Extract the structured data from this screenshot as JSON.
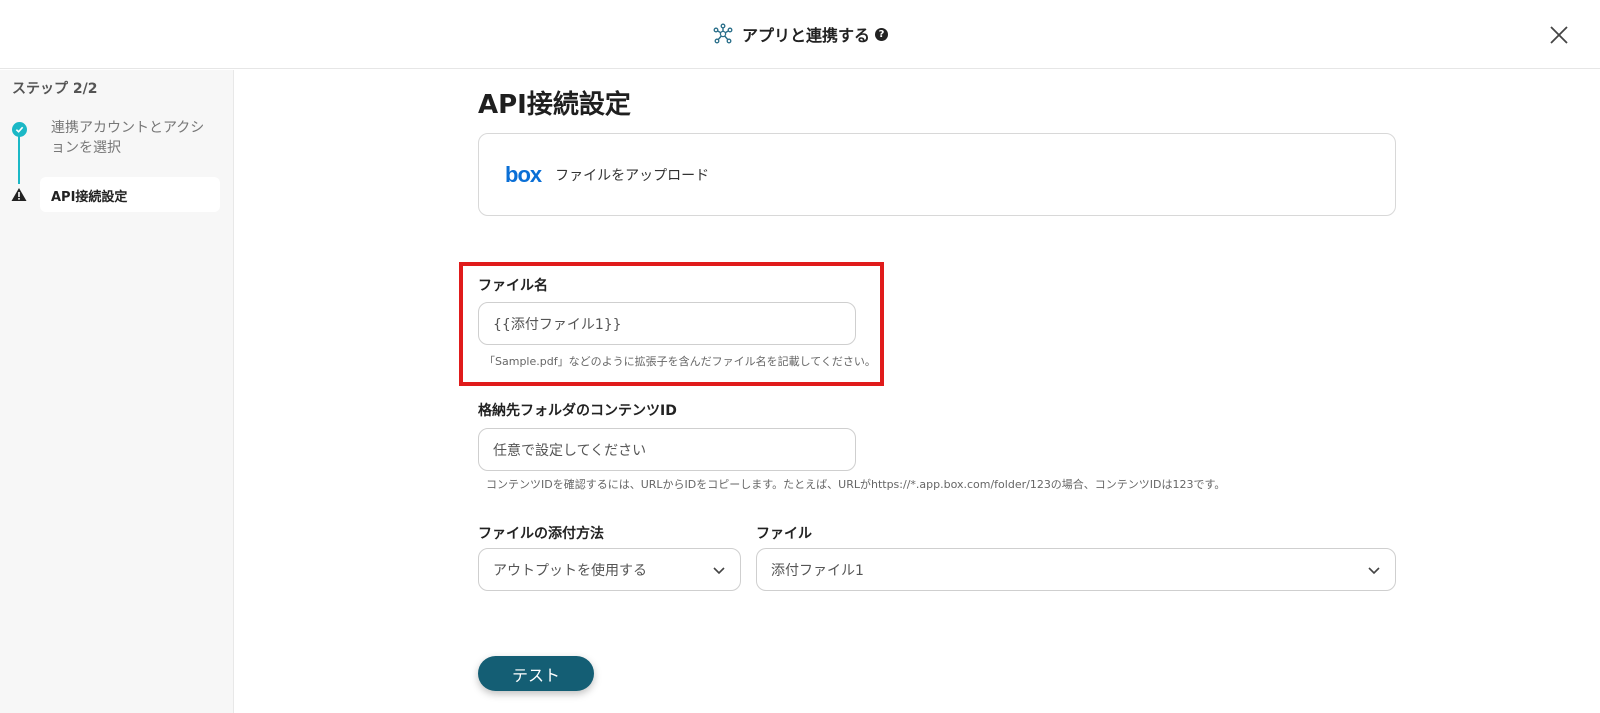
{
  "header": {
    "title": "アプリと連携する",
    "help_icon": "?"
  },
  "sidebar": {
    "step_label": "ステップ 2/2",
    "steps": [
      {
        "label": "連携アカウントとアクションを選択",
        "status": "done"
      },
      {
        "label": "API接続設定",
        "status": "current"
      }
    ]
  },
  "main": {
    "title": "API接続設定",
    "app": {
      "logo_text": "box",
      "action": "ファイルをアップロード"
    },
    "fields": {
      "file_name": {
        "label": "ファイル名",
        "value": "{{添付ファイル1}}",
        "hint": "「Sample.pdf」などのように拡張子を含んだファイル名を記載してください。"
      },
      "folder_id": {
        "label": "格納先フォルダのコンテンツID",
        "placeholder": "任意で設定してください",
        "hint": "コンテンツIDを確認するには、URLからIDをコピーします。たとえば、URLがhttps://*.app.box.com/folder/123の場合、コンテンツIDは123です。"
      },
      "attach_method": {
        "label": "ファイルの添付方法",
        "value": "アウトプットを使用する"
      },
      "file": {
        "label": "ファイル",
        "value": "添付ファイル1"
      }
    },
    "test_button": "テスト"
  },
  "colors": {
    "accent": "#1bb8c6",
    "primary_button": "#145e74",
    "highlight": "#e01b1b",
    "box_blue": "#0a6fd6"
  }
}
